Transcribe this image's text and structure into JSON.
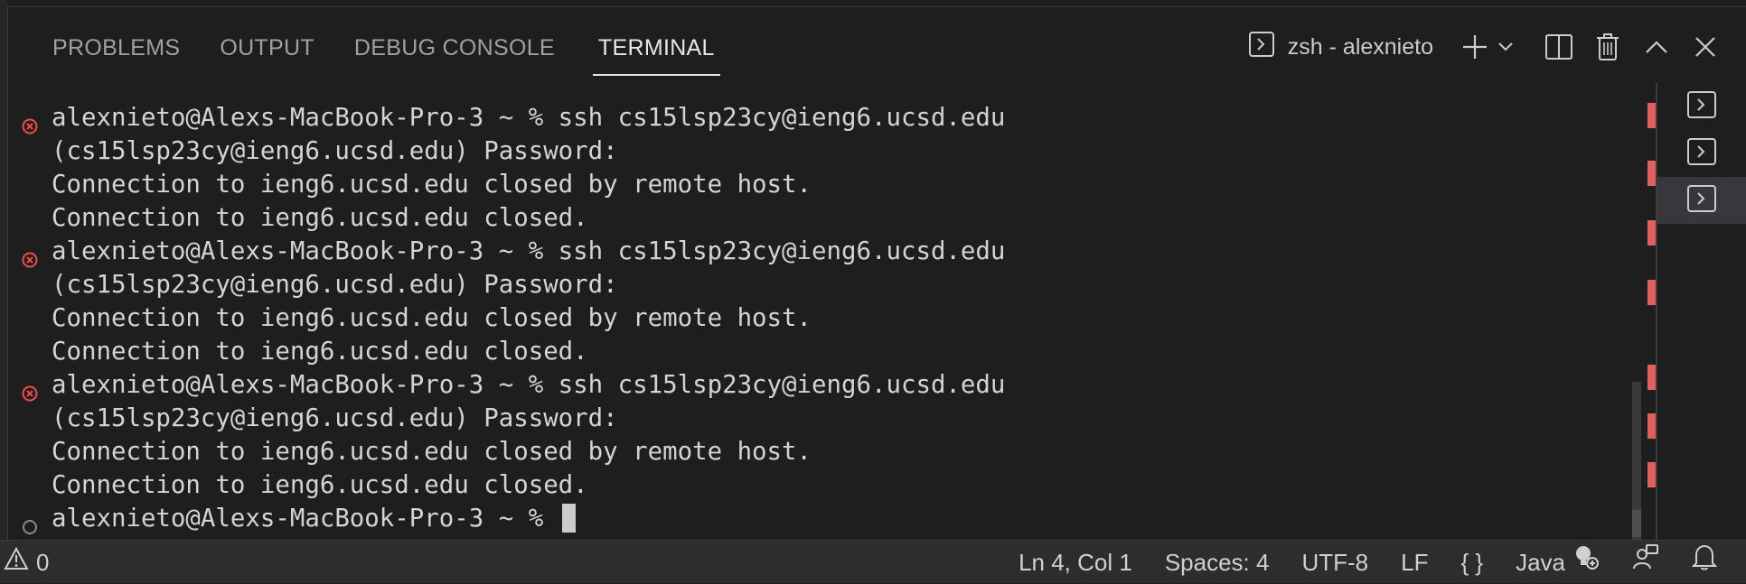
{
  "panel": {
    "tabs": [
      {
        "label": "PROBLEMS",
        "active": false
      },
      {
        "label": "OUTPUT",
        "active": false
      },
      {
        "label": "DEBUG CONSOLE",
        "active": false
      },
      {
        "label": "TERMINAL",
        "active": true
      }
    ],
    "terminal_name": "zsh - alexnieto"
  },
  "terminal": {
    "lines": [
      {
        "deco": "error",
        "text": "alexnieto@Alexs-MacBook-Pro-3 ~ % ssh cs15lsp23cy@ieng6.ucsd.edu"
      },
      {
        "deco": "none",
        "text": "(cs15lsp23cy@ieng6.ucsd.edu) Password:"
      },
      {
        "deco": "none",
        "text": "Connection to ieng6.ucsd.edu closed by remote host."
      },
      {
        "deco": "none",
        "text": "Connection to ieng6.ucsd.edu closed."
      },
      {
        "deco": "error",
        "text": "alexnieto@Alexs-MacBook-Pro-3 ~ % ssh cs15lsp23cy@ieng6.ucsd.edu"
      },
      {
        "deco": "none",
        "text": "(cs15lsp23cy@ieng6.ucsd.edu) Password:"
      },
      {
        "deco": "none",
        "text": "Connection to ieng6.ucsd.edu closed by remote host."
      },
      {
        "deco": "none",
        "text": "Connection to ieng6.ucsd.edu closed."
      },
      {
        "deco": "error",
        "text": "alexnieto@Alexs-MacBook-Pro-3 ~ % ssh cs15lsp23cy@ieng6.ucsd.edu"
      },
      {
        "deco": "none",
        "text": "(cs15lsp23cy@ieng6.ucsd.edu) Password:"
      },
      {
        "deco": "none",
        "text": "Connection to ieng6.ucsd.edu closed by remote host."
      },
      {
        "deco": "none",
        "text": "Connection to ieng6.ucsd.edu closed."
      },
      {
        "deco": "default",
        "text": "alexnieto@Alexs-MacBook-Pro-3 ~ % "
      }
    ]
  },
  "status": {
    "warnings": "0",
    "position": "Ln 4, Col 1",
    "spaces": "Spaces: 4",
    "encoding": "UTF-8",
    "eol": "LF",
    "braces": "{ }",
    "language": "Java"
  },
  "colors": {
    "error_deco": "#f14c4c",
    "ruler_mark": "#e06060",
    "background": "#1e1e1e"
  }
}
